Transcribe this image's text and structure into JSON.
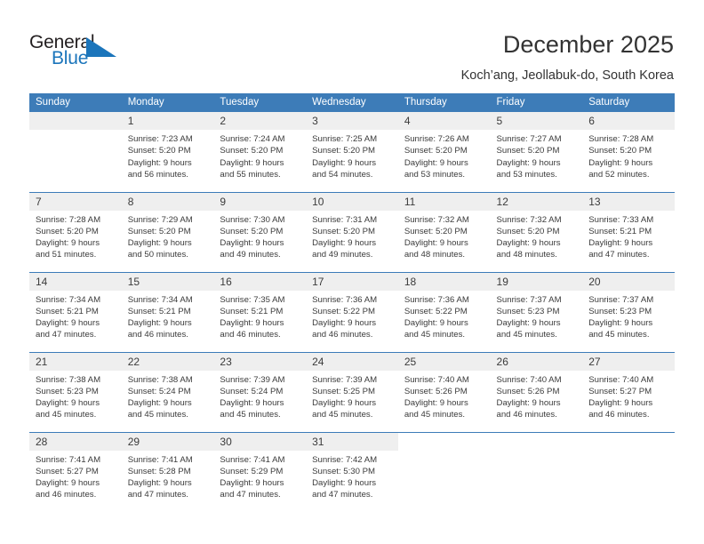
{
  "brand": {
    "name_top": "General",
    "name_bottom": "Blue",
    "triangle_color": "#1b75bb",
    "top_color": "#231f20",
    "bottom_color": "#1b75bb"
  },
  "header": {
    "title": "December 2025",
    "subtitle": "Koch’ang, Jeollabuk-do, South Korea"
  },
  "theme": {
    "header_blue": "#3d7cb8",
    "daynum_band": "#efefef",
    "text": "#3b3b3b"
  },
  "weekdays": [
    "Sunday",
    "Monday",
    "Tuesday",
    "Wednesday",
    "Thursday",
    "Friday",
    "Saturday"
  ],
  "labels": {
    "sunrise_prefix": "Sunrise: ",
    "sunset_prefix": "Sunset: ",
    "daylight_prefix": "Daylight: "
  },
  "weeks": [
    [
      {
        "day": "",
        "empty": true
      },
      {
        "day": "1",
        "sunrise": "Sunrise: 7:23 AM",
        "sunset": "Sunset: 5:20 PM",
        "daylight_1": "Daylight: 9 hours",
        "daylight_2": "and 56 minutes."
      },
      {
        "day": "2",
        "sunrise": "Sunrise: 7:24 AM",
        "sunset": "Sunset: 5:20 PM",
        "daylight_1": "Daylight: 9 hours",
        "daylight_2": "and 55 minutes."
      },
      {
        "day": "3",
        "sunrise": "Sunrise: 7:25 AM",
        "sunset": "Sunset: 5:20 PM",
        "daylight_1": "Daylight: 9 hours",
        "daylight_2": "and 54 minutes."
      },
      {
        "day": "4",
        "sunrise": "Sunrise: 7:26 AM",
        "sunset": "Sunset: 5:20 PM",
        "daylight_1": "Daylight: 9 hours",
        "daylight_2": "and 53 minutes."
      },
      {
        "day": "5",
        "sunrise": "Sunrise: 7:27 AM",
        "sunset": "Sunset: 5:20 PM",
        "daylight_1": "Daylight: 9 hours",
        "daylight_2": "and 53 minutes."
      },
      {
        "day": "6",
        "sunrise": "Sunrise: 7:28 AM",
        "sunset": "Sunset: 5:20 PM",
        "daylight_1": "Daylight: 9 hours",
        "daylight_2": "and 52 minutes."
      }
    ],
    [
      {
        "day": "7",
        "sunrise": "Sunrise: 7:28 AM",
        "sunset": "Sunset: 5:20 PM",
        "daylight_1": "Daylight: 9 hours",
        "daylight_2": "and 51 minutes."
      },
      {
        "day": "8",
        "sunrise": "Sunrise: 7:29 AM",
        "sunset": "Sunset: 5:20 PM",
        "daylight_1": "Daylight: 9 hours",
        "daylight_2": "and 50 minutes."
      },
      {
        "day": "9",
        "sunrise": "Sunrise: 7:30 AM",
        "sunset": "Sunset: 5:20 PM",
        "daylight_1": "Daylight: 9 hours",
        "daylight_2": "and 49 minutes."
      },
      {
        "day": "10",
        "sunrise": "Sunrise: 7:31 AM",
        "sunset": "Sunset: 5:20 PM",
        "daylight_1": "Daylight: 9 hours",
        "daylight_2": "and 49 minutes."
      },
      {
        "day": "11",
        "sunrise": "Sunrise: 7:32 AM",
        "sunset": "Sunset: 5:20 PM",
        "daylight_1": "Daylight: 9 hours",
        "daylight_2": "and 48 minutes."
      },
      {
        "day": "12",
        "sunrise": "Sunrise: 7:32 AM",
        "sunset": "Sunset: 5:20 PM",
        "daylight_1": "Daylight: 9 hours",
        "daylight_2": "and 48 minutes."
      },
      {
        "day": "13",
        "sunrise": "Sunrise: 7:33 AM",
        "sunset": "Sunset: 5:21 PM",
        "daylight_1": "Daylight: 9 hours",
        "daylight_2": "and 47 minutes."
      }
    ],
    [
      {
        "day": "14",
        "sunrise": "Sunrise: 7:34 AM",
        "sunset": "Sunset: 5:21 PM",
        "daylight_1": "Daylight: 9 hours",
        "daylight_2": "and 47 minutes."
      },
      {
        "day": "15",
        "sunrise": "Sunrise: 7:34 AM",
        "sunset": "Sunset: 5:21 PM",
        "daylight_1": "Daylight: 9 hours",
        "daylight_2": "and 46 minutes."
      },
      {
        "day": "16",
        "sunrise": "Sunrise: 7:35 AM",
        "sunset": "Sunset: 5:21 PM",
        "daylight_1": "Daylight: 9 hours",
        "daylight_2": "and 46 minutes."
      },
      {
        "day": "17",
        "sunrise": "Sunrise: 7:36 AM",
        "sunset": "Sunset: 5:22 PM",
        "daylight_1": "Daylight: 9 hours",
        "daylight_2": "and 46 minutes."
      },
      {
        "day": "18",
        "sunrise": "Sunrise: 7:36 AM",
        "sunset": "Sunset: 5:22 PM",
        "daylight_1": "Daylight: 9 hours",
        "daylight_2": "and 45 minutes."
      },
      {
        "day": "19",
        "sunrise": "Sunrise: 7:37 AM",
        "sunset": "Sunset: 5:23 PM",
        "daylight_1": "Daylight: 9 hours",
        "daylight_2": "and 45 minutes."
      },
      {
        "day": "20",
        "sunrise": "Sunrise: 7:37 AM",
        "sunset": "Sunset: 5:23 PM",
        "daylight_1": "Daylight: 9 hours",
        "daylight_2": "and 45 minutes."
      }
    ],
    [
      {
        "day": "21",
        "sunrise": "Sunrise: 7:38 AM",
        "sunset": "Sunset: 5:23 PM",
        "daylight_1": "Daylight: 9 hours",
        "daylight_2": "and 45 minutes."
      },
      {
        "day": "22",
        "sunrise": "Sunrise: 7:38 AM",
        "sunset": "Sunset: 5:24 PM",
        "daylight_1": "Daylight: 9 hours",
        "daylight_2": "and 45 minutes."
      },
      {
        "day": "23",
        "sunrise": "Sunrise: 7:39 AM",
        "sunset": "Sunset: 5:24 PM",
        "daylight_1": "Daylight: 9 hours",
        "daylight_2": "and 45 minutes."
      },
      {
        "day": "24",
        "sunrise": "Sunrise: 7:39 AM",
        "sunset": "Sunset: 5:25 PM",
        "daylight_1": "Daylight: 9 hours",
        "daylight_2": "and 45 minutes."
      },
      {
        "day": "25",
        "sunrise": "Sunrise: 7:40 AM",
        "sunset": "Sunset: 5:26 PM",
        "daylight_1": "Daylight: 9 hours",
        "daylight_2": "and 45 minutes."
      },
      {
        "day": "26",
        "sunrise": "Sunrise: 7:40 AM",
        "sunset": "Sunset: 5:26 PM",
        "daylight_1": "Daylight: 9 hours",
        "daylight_2": "and 46 minutes."
      },
      {
        "day": "27",
        "sunrise": "Sunrise: 7:40 AM",
        "sunset": "Sunset: 5:27 PM",
        "daylight_1": "Daylight: 9 hours",
        "daylight_2": "and 46 minutes."
      }
    ],
    [
      {
        "day": "28",
        "sunrise": "Sunrise: 7:41 AM",
        "sunset": "Sunset: 5:27 PM",
        "daylight_1": "Daylight: 9 hours",
        "daylight_2": "and 46 minutes."
      },
      {
        "day": "29",
        "sunrise": "Sunrise: 7:41 AM",
        "sunset": "Sunset: 5:28 PM",
        "daylight_1": "Daylight: 9 hours",
        "daylight_2": "and 47 minutes."
      },
      {
        "day": "30",
        "sunrise": "Sunrise: 7:41 AM",
        "sunset": "Sunset: 5:29 PM",
        "daylight_1": "Daylight: 9 hours",
        "daylight_2": "and 47 minutes."
      },
      {
        "day": "31",
        "sunrise": "Sunrise: 7:42 AM",
        "sunset": "Sunset: 5:30 PM",
        "daylight_1": "Daylight: 9 hours",
        "daylight_2": "and 47 minutes."
      },
      {
        "day": "",
        "empty": true,
        "blank": true
      },
      {
        "day": "",
        "empty": true,
        "blank": true
      },
      {
        "day": "",
        "empty": true,
        "blank": true
      }
    ]
  ]
}
